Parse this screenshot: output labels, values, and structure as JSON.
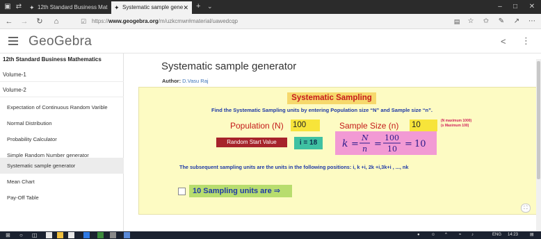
{
  "browser": {
    "tabs": [
      {
        "label": "12th Standard Business Mat"
      },
      {
        "label": "Systematic sample gene"
      }
    ],
    "url_prefix": "https://",
    "url_domain": "www.geogebra.org",
    "url_path": "/m/uzkcmwr#material/uawedcqp"
  },
  "header": {
    "logo": "GeoGebra"
  },
  "sidebar": {
    "book_title": "12th Standard Business Mathematics",
    "volume1": "Volume-1",
    "volume2": "Volume-2",
    "items": [
      {
        "label": "Expectation of Continuous Random Varible"
      },
      {
        "label": "Normal Distribution"
      },
      {
        "label": "Probability Calculator"
      },
      {
        "label": "Simple Random Number generator"
      },
      {
        "label": "Systematic sample generator"
      },
      {
        "label": "Mean Chart"
      },
      {
        "label": "Pay-Off Table"
      }
    ]
  },
  "main": {
    "title": "Systematic sample generator",
    "author_label": "Author:",
    "author_name": "D.Vasu Raj"
  },
  "applet": {
    "heading": "Systematic Sampling",
    "instructions": "Find the Systematic Sampling units by entering Population size “N” and Sample size “n”.",
    "population_label": "Population (N)",
    "population_value": "100",
    "sample_label": "Sample Size (n)",
    "sample_value": "10",
    "note_n": "(N maximum 1000)",
    "note_s": "(s Maximum 100)",
    "random_start_button": "Random Start  Value",
    "i_value": "i = 18",
    "formula": {
      "k": "k",
      "N": "N",
      "n": "n",
      "num": "100",
      "den": "10",
      "result": "10"
    },
    "subsequent_text": "The subsequent sampling units are the units in the following positions:  i,  k +i, 2k +i,3k+i , ..., nk",
    "units_label": "10 Sampling units are ⇒"
  },
  "taskbar": {
    "lang": "ENG",
    "time": "14:23"
  }
}
